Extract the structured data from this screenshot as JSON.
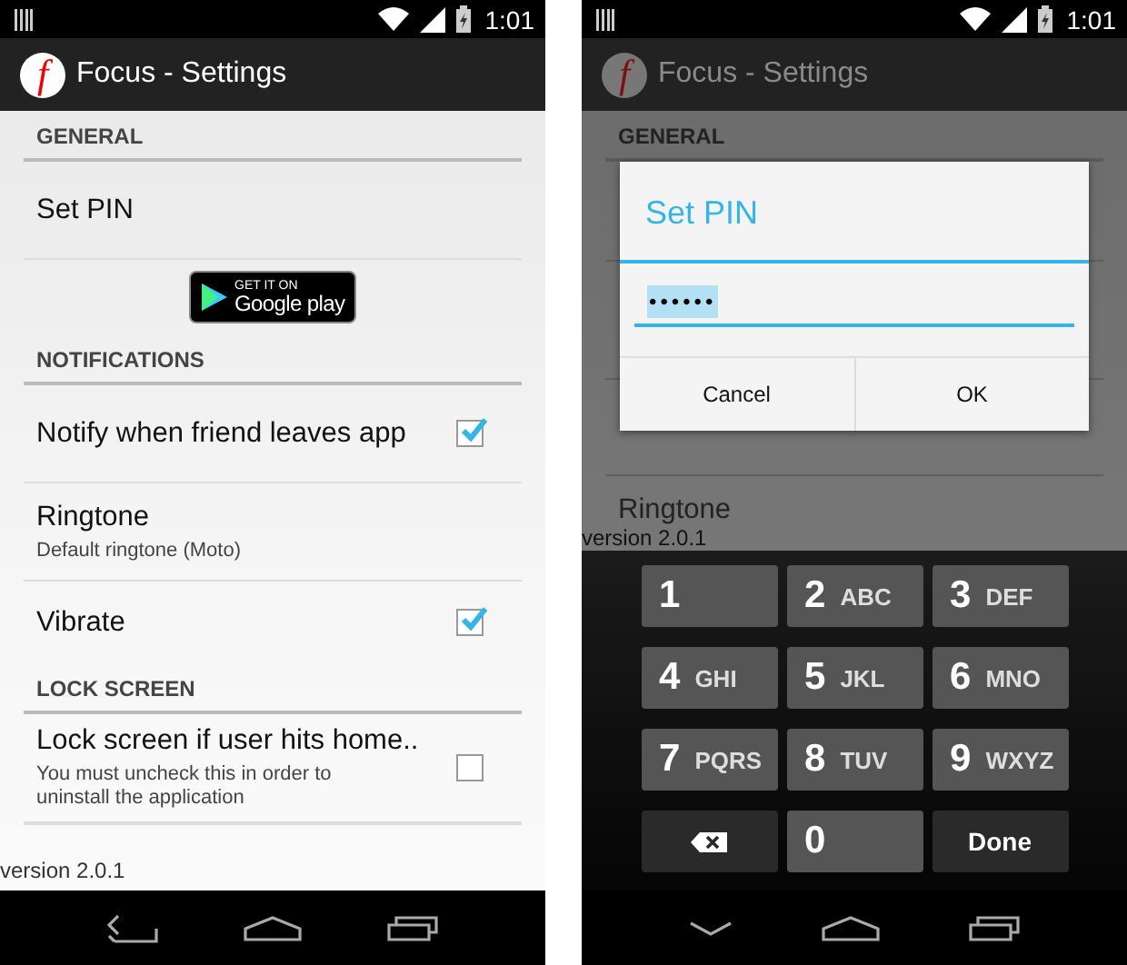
{
  "left_screen": {
    "status_bar": {
      "time": "1:01"
    },
    "app_bar": {
      "logo_letter": "f",
      "title": "Focus - Settings"
    },
    "sections": [
      {
        "header": "GENERAL",
        "items": [
          {
            "kind": "action",
            "title": "Set PIN"
          },
          {
            "kind": "badge",
            "small": "GET IT ON",
            "big": "Google play"
          }
        ]
      },
      {
        "header": "NOTIFICATIONS",
        "items": [
          {
            "kind": "checkbox",
            "title": "Notify when friend leaves app",
            "checked": true
          },
          {
            "kind": "text",
            "title": "Ringtone",
            "summary": "Default ringtone (Moto)"
          },
          {
            "kind": "checkbox",
            "title": "Vibrate",
            "checked": true
          }
        ]
      },
      {
        "header": "LOCK SCREEN",
        "items": [
          {
            "kind": "checkbox",
            "title": "Lock screen if user hits home..",
            "summary": "You must uncheck this in order to uninstall the application",
            "checked": false
          }
        ]
      }
    ],
    "version": "version 2.0.1"
  },
  "right_screen": {
    "status_bar": {
      "time": "1:01"
    },
    "app_bar": {
      "logo_letter": "f",
      "title": "Focus - Settings"
    },
    "background": {
      "header": "GENERAL",
      "row_title": "Ringtone",
      "version": "version 2.0.1"
    },
    "dialog": {
      "title": "Set PIN",
      "value": "••••••",
      "buttons": [
        "Cancel",
        "OK"
      ]
    },
    "keypad": [
      {
        "kind": "digit",
        "digit": "1"
      },
      {
        "kind": "digit",
        "digit": "2",
        "letters": "ABC"
      },
      {
        "kind": "digit",
        "digit": "3",
        "letters": "DEF"
      },
      {
        "kind": "digit",
        "digit": "4",
        "letters": "GHI"
      },
      {
        "kind": "digit",
        "digit": "5",
        "letters": "JKL"
      },
      {
        "kind": "digit",
        "digit": "6",
        "letters": "MNO"
      },
      {
        "kind": "digit",
        "digit": "7",
        "letters": "PQRS"
      },
      {
        "kind": "digit",
        "digit": "8",
        "letters": "TUV"
      },
      {
        "kind": "digit",
        "digit": "9",
        "letters": "WXYZ"
      },
      {
        "kind": "backspace"
      },
      {
        "kind": "digit",
        "digit": "0"
      },
      {
        "kind": "done",
        "label": "Done"
      }
    ]
  }
}
